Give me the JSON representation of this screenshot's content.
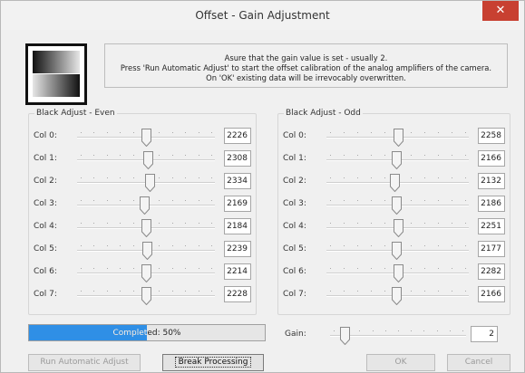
{
  "window": {
    "title": "Offset - Gain Adjustment",
    "close_label": "✕"
  },
  "info": {
    "line1": "Asure that the gain value is set - usually 2.",
    "line2": "Press 'Run Automatic Adjust' to start the offset calibration of the analog amplifiers of the camera.",
    "line3": "On 'OK'  existing data will be irrevocably overwritten."
  },
  "groups": [
    {
      "title": "Black Adjust - Even",
      "rows": [
        {
          "label": "Col 0:",
          "value": "2226",
          "level": 0.5
        },
        {
          "label": "Col 1:",
          "value": "2308",
          "level": 0.52
        },
        {
          "label": "Col 2:",
          "value": "2334",
          "level": 0.53
        },
        {
          "label": "Col 3:",
          "value": "2169",
          "level": 0.49
        },
        {
          "label": "Col 4:",
          "value": "2184",
          "level": 0.5
        },
        {
          "label": "Col 5:",
          "value": "2239",
          "level": 0.51
        },
        {
          "label": "Col 6:",
          "value": "2214",
          "level": 0.5
        },
        {
          "label": "Col 7:",
          "value": "2228",
          "level": 0.5
        }
      ]
    },
    {
      "title": "Black Adjust - Odd",
      "rows": [
        {
          "label": "Col 0:",
          "value": "2258",
          "level": 0.51
        },
        {
          "label": "Col 1:",
          "value": "2166",
          "level": 0.49
        },
        {
          "label": "Col 2:",
          "value": "2132",
          "level": 0.48
        },
        {
          "label": "Col 3:",
          "value": "2186",
          "level": 0.49
        },
        {
          "label": "Col 4:",
          "value": "2251",
          "level": 0.51
        },
        {
          "label": "Col 5:",
          "value": "2177",
          "level": 0.49
        },
        {
          "label": "Col 6:",
          "value": "2282",
          "level": 0.51
        },
        {
          "label": "Col 7:",
          "value": "2166",
          "level": 0.49
        }
      ]
    }
  ],
  "progress": {
    "text": "Completed: 50%",
    "percent": 50
  },
  "gain": {
    "label": "Gain:",
    "value": "2",
    "level": 0.08
  },
  "buttons": {
    "run": "Run Automatic Adjust",
    "break": "Break Processing",
    "ok": "OK",
    "cancel": "Cancel"
  },
  "colors": {
    "close": "#c84031",
    "progress_fill": "#2f8fe6"
  },
  "icons": {
    "logo": "gradient-logo-icon",
    "close": "close-icon",
    "thumb": "slider-thumb-icon"
  }
}
